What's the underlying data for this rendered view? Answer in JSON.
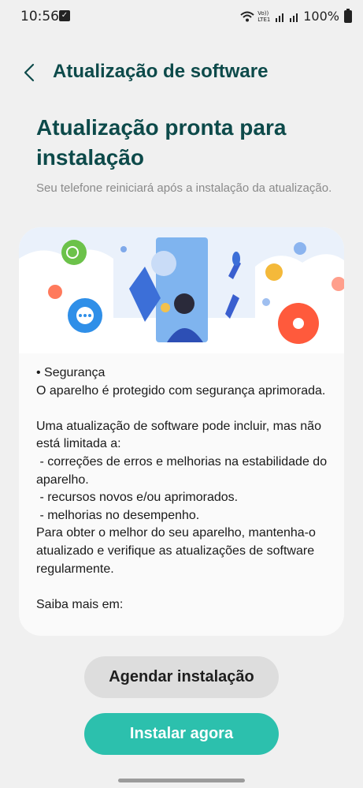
{
  "status_bar": {
    "time": "10:56",
    "battery": "100%",
    "network_label": "Vo)) LTE1"
  },
  "header": {
    "title": "Atualização de software"
  },
  "main": {
    "title": "Atualização pronta para instalação",
    "subtitle": "Seu telefone reiniciará após a instalação da atualização.",
    "release_notes": "• Segurança\nO aparelho é protegido com segurança aprimorada.\n\nUma atualização de software pode incluir, mas não está limitada a:\n - correções de erros e melhorias na estabilidade do aparelho.\n - recursos novos e/ou aprimorados.\n - melhorias no desempenho.\nPara obter o melhor do seu aparelho, mantenha-o atualizado e verifique as atualizações de software regularmente.\n\nSaiba mais em:"
  },
  "actions": {
    "schedule_label": "Agendar instalação",
    "install_label": "Instalar agora"
  },
  "colors": {
    "accent": "#2cc0ad",
    "title": "#0d4a4a",
    "background": "#f0f0f0"
  },
  "icons": [
    "check-icon",
    "wifi-icon",
    "signal-icon",
    "battery-icon",
    "back-arrow-icon"
  ]
}
